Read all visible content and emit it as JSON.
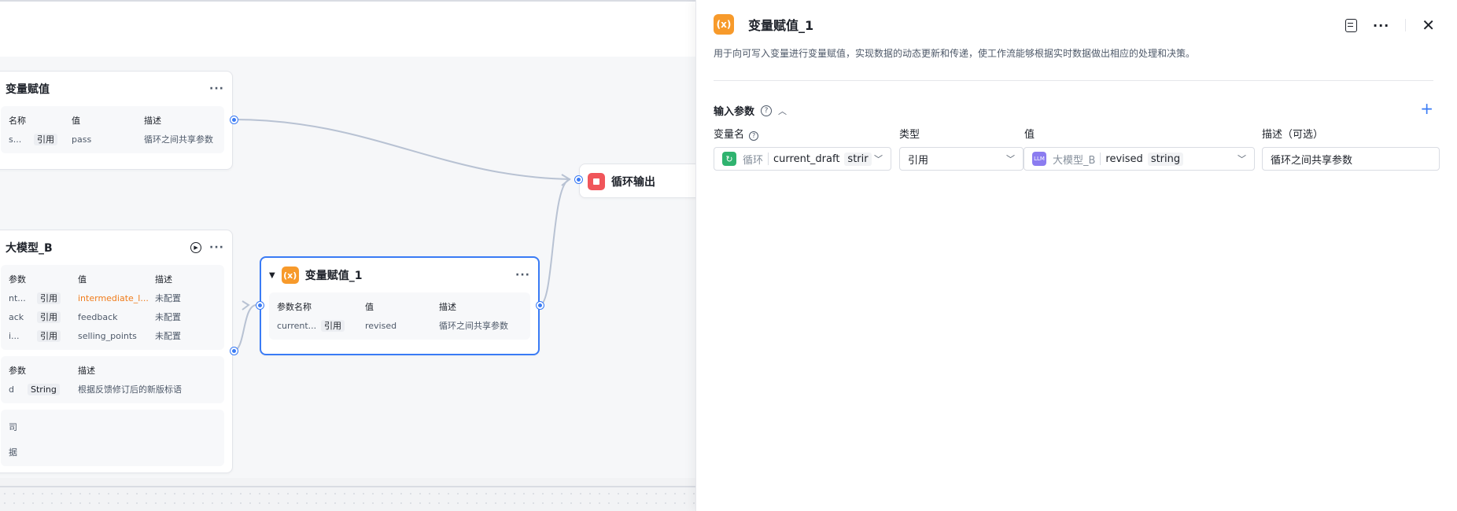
{
  "canvas": {
    "node_assign": {
      "title": "变量赋值",
      "cols": [
        "名称",
        "值",
        "描述"
      ],
      "row": {
        "name": "s...",
        "type": "引用",
        "value": "pass",
        "desc": "循环之间共享参数"
      }
    },
    "node_llm": {
      "title": "大模型_B",
      "input_cols": [
        "参数",
        "值",
        "描述"
      ],
      "inputs": [
        {
          "name": "nt...",
          "type": "引用",
          "value": "intermediate_l...",
          "desc": "未配置"
        },
        {
          "name": "ack",
          "type": "引用",
          "value": "feedback",
          "desc": "未配置"
        },
        {
          "name": "i...",
          "type": "引用",
          "value": "selling_points",
          "desc": "未配置"
        }
      ],
      "output_cols": [
        "参数",
        "描述"
      ],
      "output": {
        "name": "d",
        "type": "String",
        "desc": "根据反馈修订后的新版标语"
      },
      "extra_rows": [
        "司",
        "据"
      ]
    },
    "node_assign1": {
      "title": "变量赋值_1",
      "cols": [
        "参数名称",
        "值",
        "描述"
      ],
      "row": {
        "name": "current...",
        "type": "引用",
        "value": "revised",
        "desc": "循环之间共享参数"
      }
    },
    "node_output": {
      "title": "循环输出"
    }
  },
  "panel": {
    "icon_text": "(x)",
    "title": "变量赋值_1",
    "description": "用于向可写入变量进行变量赋值，实现数据的动态更新和传递，使工作流能够根据实时数据做出相应的处理和决策。",
    "section_title": "输入参数",
    "columns": {
      "name": "变量名",
      "type": "类型",
      "value": "值",
      "desc": "描述（可选）"
    },
    "row": {
      "var_source": "循环",
      "var_name": "current_draft",
      "var_type": "strir",
      "type": "引用",
      "value_source": "大模型_B",
      "value_name": "revised",
      "value_type": "string",
      "desc": "循环之间共享参数"
    },
    "badge_llm": "LLM"
  }
}
